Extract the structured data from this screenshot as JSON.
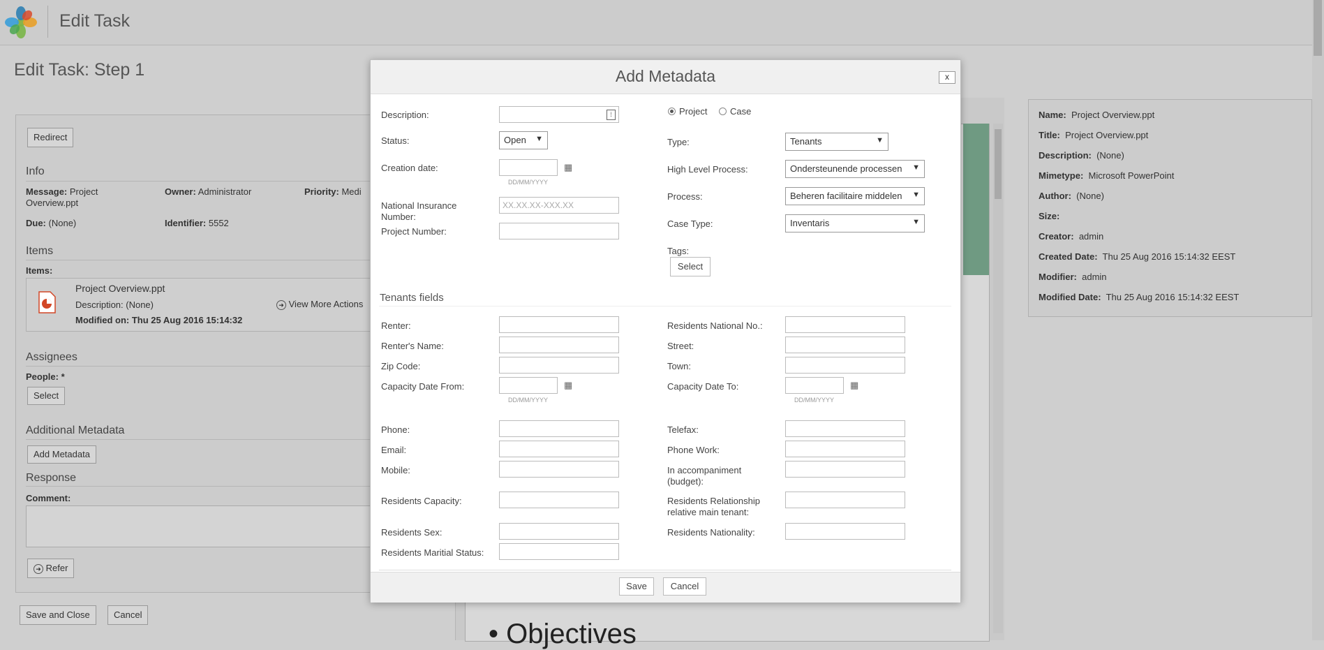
{
  "header": {
    "title": "Edit Task"
  },
  "page": {
    "title": "Edit Task: Step 1"
  },
  "left": {
    "redirect_label": "Redirect",
    "info_title": "Info",
    "message_label": "Message:",
    "message_value_1": "Project",
    "message_value_2": "Overview.ppt",
    "owner_label": "Owner:",
    "owner_value": "Administrator",
    "priority_label": "Priority:",
    "priority_value": "Medi",
    "due_label": "Due:",
    "due_value": "(None)",
    "identifier_label": "Identifier:",
    "identifier_value": "5552",
    "items_title": "Items",
    "items_label": "Items:",
    "item_name": "Project Overview.ppt",
    "item_description": "Description: (None)",
    "item_modified": "Modified on: Thu 25 Aug 2016 15:14:32",
    "view_more": "View More Actions",
    "assignees_title": "Assignees",
    "people_label": "People: *",
    "select_label": "Select",
    "additional_title": "Additional Metadata",
    "add_metadata_label": "Add Metadata",
    "response_title": "Response",
    "comment_label": "Comment:",
    "refer_label": "Refer",
    "save_close_label": "Save and Close",
    "cancel_label": "Cancel"
  },
  "preview": {
    "objectives_text": "• Objectives"
  },
  "right": {
    "rows": [
      {
        "label": "Name:",
        "value": "Project Overview.ppt"
      },
      {
        "label": "Title:",
        "value": "Project Overview.ppt"
      },
      {
        "label": "Description:",
        "value": "(None)"
      },
      {
        "label": "Mimetype:",
        "value": "Microsoft PowerPoint"
      },
      {
        "label": "Author:",
        "value": "(None)"
      },
      {
        "label": "Size:",
        "value": ""
      },
      {
        "label": "Creator:",
        "value": "admin"
      },
      {
        "label": "Created Date:",
        "value": "Thu 25 Aug 2016 15:14:32 EEST"
      },
      {
        "label": "Modifier:",
        "value": "admin"
      },
      {
        "label": "Modified Date:",
        "value": "Thu 25 Aug 2016 15:14:32 EEST"
      }
    ]
  },
  "modal": {
    "title": "Add Metadata",
    "close_label": "x",
    "description_label": "Description:",
    "description_value": "",
    "status_label": "Status:",
    "status_value": "Open",
    "creation_date_label": "Creation date:",
    "date_hint": "DD/MM/YYYY",
    "nin_label_1": "National Insurance",
    "nin_label_2": "Number:",
    "nin_placeholder": "XX.XX.XX-XXX.XX",
    "project_number_label": "Project Number:",
    "radio_project": "Project",
    "radio_case": "Case",
    "type_label": "Type:",
    "type_value": "Tenants",
    "hlp_label": "High Level Process:",
    "hlp_value": "Ondersteunende processen",
    "process_label": "Process:",
    "process_value": "Beheren facilitaire middelen",
    "case_type_label": "Case Type:",
    "case_type_value": "Inventaris",
    "tags_label": "Tags:",
    "tags_select_label": "Select",
    "tenants_title": "Tenants fields",
    "left_fields": [
      "Renter:",
      "Renter's Name:",
      "Zip Code:",
      "Capacity Date From:",
      "Phone:",
      "Email:",
      "Mobile:",
      "Residents Capacity:",
      "Residents Sex:",
      "Residents Maritial Status:"
    ],
    "right_fields": [
      "Residents National No.:",
      "Street:",
      "Town:",
      "Capacity Date To:",
      "Telefax:",
      "Phone Work:",
      "In accompaniment (budget):",
      "Residents Relationship relative main tenant:",
      "Residents Nationality:"
    ],
    "save_label": "Save",
    "cancel_label": "Cancel"
  }
}
